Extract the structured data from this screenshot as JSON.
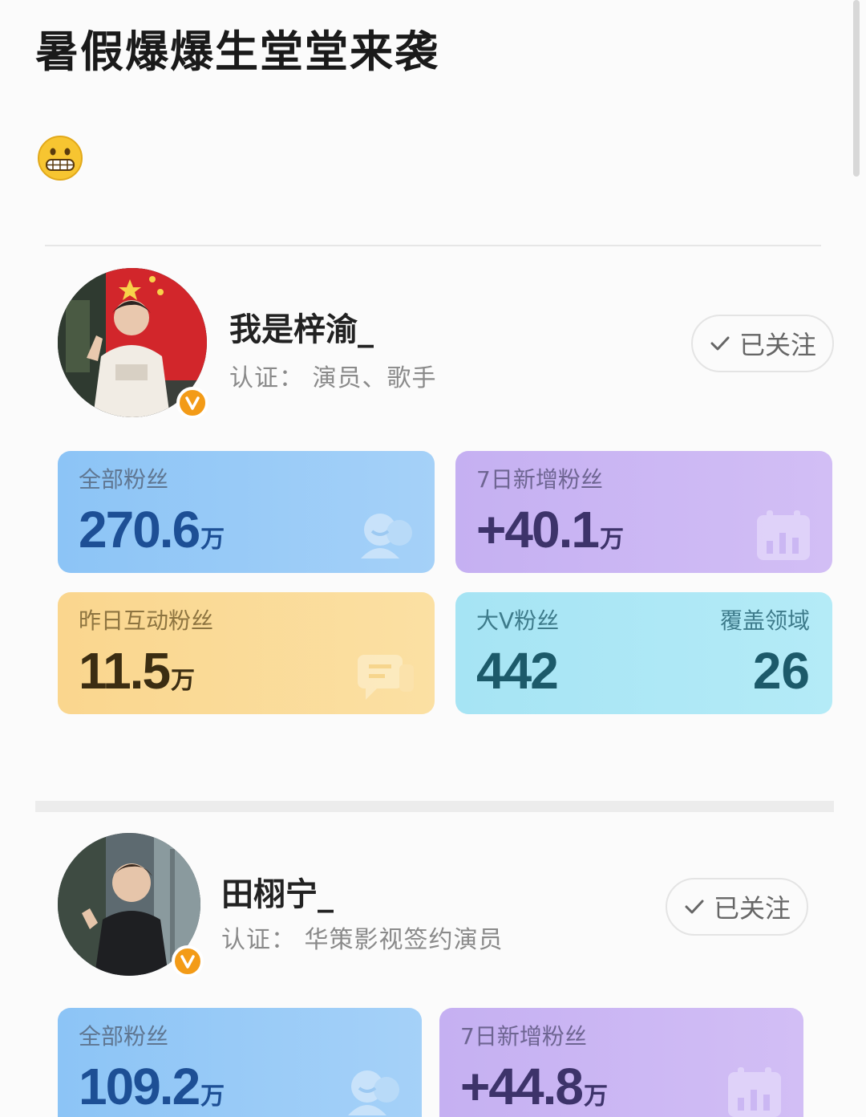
{
  "post": {
    "title": "暑假爆爆生堂堂来袭",
    "emoji": "grimacing-face-emoji"
  },
  "profiles": [
    {
      "name": "我是梓渝_",
      "certification": "认证：  演员、歌手",
      "follow_label": "已关注",
      "stats": {
        "total_fans": {
          "label": "全部粉丝",
          "value": "270.6",
          "unit": "万"
        },
        "new_fans_7d": {
          "label": "7日新增粉丝",
          "value": "+40.1",
          "unit": "万"
        },
        "interactive_fans_yesterday": {
          "label": "昨日互动粉丝",
          "value": "11.5",
          "unit": "万"
        },
        "bigv_fans": {
          "label": "大V粉丝",
          "value": "442",
          "coverage_label": "覆盖领域",
          "coverage_value": "26"
        }
      }
    },
    {
      "name": "田栩宁_",
      "certification": "认证：  华策影视签约演员",
      "follow_label": "已关注",
      "stats": {
        "total_fans": {
          "label": "全部粉丝",
          "value": "109.2",
          "unit": "万"
        },
        "new_fans_7d": {
          "label": "7日新增粉丝",
          "value": "+44.8",
          "unit": "万"
        }
      }
    }
  ],
  "colors": {
    "blue_card": "#8cc4f6",
    "purple_card": "#c5b0f2",
    "yellow_card": "#fad68e",
    "cyan_card": "#a6e4f4",
    "verified_badge": "#f39b17"
  }
}
